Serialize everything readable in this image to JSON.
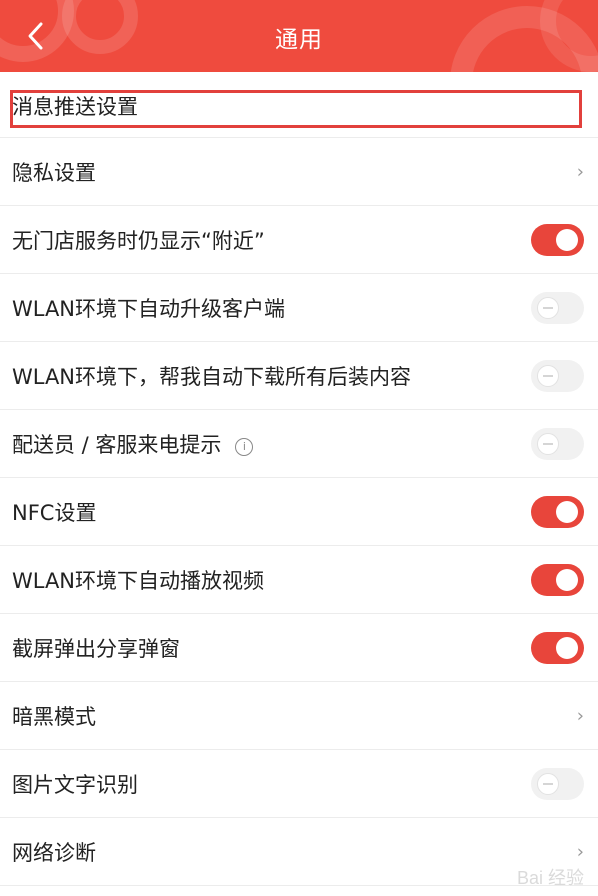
{
  "header": {
    "title": "通用",
    "back_icon": "chevron-left-icon",
    "background": "#ef4b3e"
  },
  "accent": "#e8453b",
  "items": [
    {
      "label": "消息推送设置",
      "control": "highlighted"
    },
    {
      "label": "隐私设置",
      "control": "chevron"
    },
    {
      "label": "无门店服务时仍显示“附近”",
      "control": "toggle",
      "on": true
    },
    {
      "label": "WLAN环境下自动升级客户端",
      "control": "toggle",
      "on": false
    },
    {
      "label": "WLAN环境下，帮我自动下载所有后装内容",
      "control": "toggle",
      "on": false
    },
    {
      "label": "配送员 / 客服来电提示",
      "control": "toggle",
      "on": false,
      "info_icon": "info-icon"
    },
    {
      "label": "NFC设置",
      "control": "toggle",
      "on": true
    },
    {
      "label": "WLAN环境下自动播放视频",
      "control": "toggle",
      "on": true
    },
    {
      "label": "截屏弹出分享弹窗",
      "control": "toggle",
      "on": true
    },
    {
      "label": "暗黑模式",
      "control": "chevron"
    },
    {
      "label": "图片文字识别",
      "control": "toggle",
      "on": false
    },
    {
      "label": "网络诊断",
      "control": "chevron"
    }
  ],
  "chevron_glyph": "›",
  "info_glyph": "i",
  "watermark": "Bai 经验"
}
